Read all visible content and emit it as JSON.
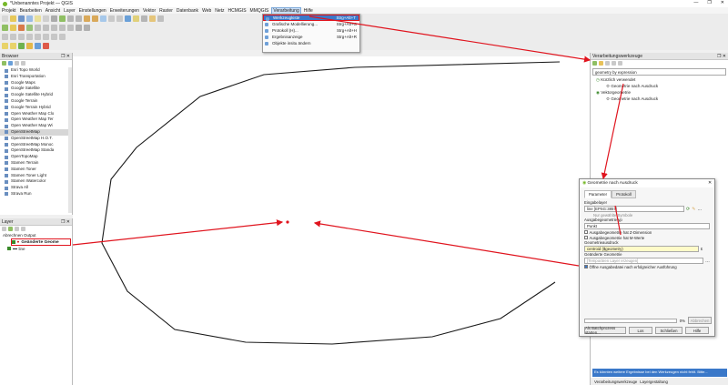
{
  "window": {
    "title": "*Unbenanntes Projekt — QGIS"
  },
  "menubar": [
    "Projekt",
    "Bearbeiten",
    "Ansicht",
    "Layer",
    "Einstellungen",
    "Erweiterungen",
    "Vektor",
    "Raster",
    "Datenbank",
    "Web",
    "Netz",
    "HCMGIS",
    "MMQGIS",
    "Verarbeitung",
    "Hilfe"
  ],
  "processing_menu": {
    "items": [
      {
        "label": "Werkzeugkiste",
        "shortcut": "Strg+Alt+T"
      },
      {
        "label": "Grafische Modellierung...",
        "shortcut": "Strg+Alt+G"
      },
      {
        "label": "Protokoll (H)...",
        "shortcut": "Strg+Alt+H"
      },
      {
        "label": "Ergebnisanzeige",
        "shortcut": "Strg+Alt+R"
      },
      {
        "label": "Objekte insitu ändern",
        "shortcut": ""
      }
    ]
  },
  "browser": {
    "title": "Browser",
    "items": [
      "Esri Topo World",
      "Esri Transportation",
      "Google Maps",
      "Google Satellite",
      "Google Satellite Hybrid",
      "Google Terrain",
      "Google Terrain Hybrid",
      "Open Weather Map Clo",
      "Open Weather Map Ter",
      "Open Weather Map Wi",
      "OpenStreetMap",
      "OpenStreetMap H.O.T.",
      "OpenStreetMap Monoc",
      "OpenStreetMap Standa",
      "OpenTopoMap",
      "Stamen Terrain",
      "Stamen Toner",
      "Stamen Toner Light",
      "Stamen Watercolor",
      "Strava All",
      "Strava Run"
    ],
    "selected_index": 10
  },
  "layers": {
    "title": "Layer",
    "group": "Abrechnen Output",
    "items": [
      "Geänderte Geome",
      "line"
    ]
  },
  "processing_toolbox": {
    "title": "Verarbeitungswerkzeuge",
    "search_value": "geometry by expression",
    "tree": [
      "Kürzlich verwendet",
      "Geometrie nach Ausdruck",
      "Vektorgeometrie",
      "Geometrie nach Ausdruck"
    ],
    "status": "Es könnten weitere Ergebnisse bei den Werkzeugen nicht fehlt. Bitte...",
    "tabs": [
      "Verarbeitungswerkzeuge",
      "Layergestaltung"
    ]
  },
  "dialog": {
    "title": "Geometrie nach Ausdruck",
    "tabs": [
      "Parameter",
      "Protokoll"
    ],
    "input_label": "Eingabelayer",
    "input_value": "line [EPSG:3857]",
    "selected_only": "Nur gewählte Symbole",
    "output_type_label": "Ausgabegeometrietyp",
    "output_type_value": "Punkt",
    "check_z": "Ausgabegeometrie hat Z-Dimension",
    "check_m": "Ausgabegeometrie hat M-Werte",
    "expr_label": "Geometrieausdruck",
    "expr_value": "centroid ($geometry)",
    "out_label": "Geänderte Geometrie",
    "out_placeholder": "[Temporären Layer erzeugen]",
    "check_open": "Öffne Ausgabedatei nach erfolgreicher Ausführung",
    "progress": "0%",
    "btn_abort": "Abbrechen",
    "btn_batch": "Als Batchprozess starten...",
    "btn_run": "Los",
    "btn_close": "Schließen",
    "btn_help": "Hilfe"
  },
  "colors": {
    "accent_red": "#e0141e",
    "qgis_green": "#76b828"
  }
}
